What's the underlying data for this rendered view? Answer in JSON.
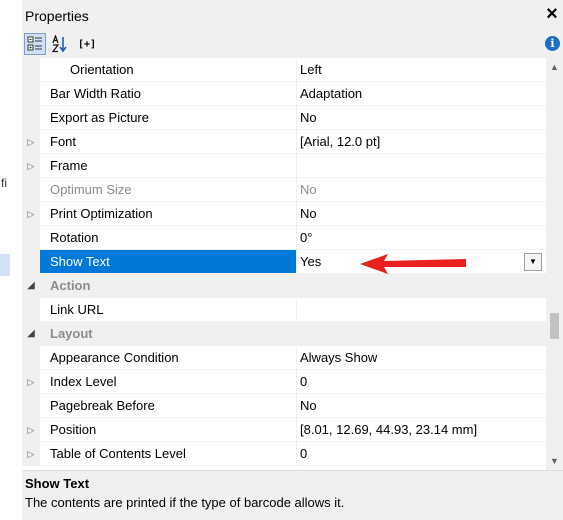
{
  "panel": {
    "title": "Properties",
    "close_glyph": "×",
    "toolbar": {
      "categorized_icon": "categorized-view-icon",
      "alphabetical_icon": "sort-alphabetical-icon",
      "expand_label": "[+]",
      "info_glyph": "i"
    }
  },
  "left_strip": {
    "partial_text": "fi"
  },
  "rows": [
    {
      "label": "Orientation",
      "value": "Left"
    },
    {
      "label": "Bar Width Ratio",
      "value": "Adaptation"
    },
    {
      "label": "Export as Picture",
      "value": "No"
    },
    {
      "label": "Font",
      "value": "[Arial, 12.0 pt]",
      "expand": "▷"
    },
    {
      "label": "Frame",
      "value": "",
      "expand": "▷"
    },
    {
      "label": "Optimum Size",
      "value": "No"
    },
    {
      "label": "Print Optimization",
      "value": "No",
      "expand": "▷"
    },
    {
      "label": "Rotation",
      "value": "0°"
    },
    {
      "label": "Show Text",
      "value": "Yes"
    },
    {
      "label": "Action",
      "expand": "◢"
    },
    {
      "label": "Link URL",
      "value": ""
    },
    {
      "label": "Layout",
      "expand": "◢"
    },
    {
      "label": "Appearance Condition",
      "value": "Always Show"
    },
    {
      "label": "Index Level",
      "value": "0",
      "expand": "▷"
    },
    {
      "label": "Pagebreak Before",
      "value": "No"
    },
    {
      "label": "Position",
      "value": "[8.01, 12.69, 44.93, 23.14 mm]",
      "expand": "▷"
    },
    {
      "label": "Table of Contents Level",
      "value": "0",
      "expand": "▷"
    }
  ],
  "dropdown_glyph": "▼",
  "scroll": {
    "up_glyph": "▲",
    "down_glyph": "▼"
  },
  "description": {
    "title": "Show Text",
    "text": "The contents are printed if the type of barcode allows it."
  },
  "colors": {
    "selection": "#0078d7",
    "annotation_arrow": "#e8201e",
    "category_bg": "#f0f0f0",
    "disabled_text": "#8c8c8c"
  }
}
